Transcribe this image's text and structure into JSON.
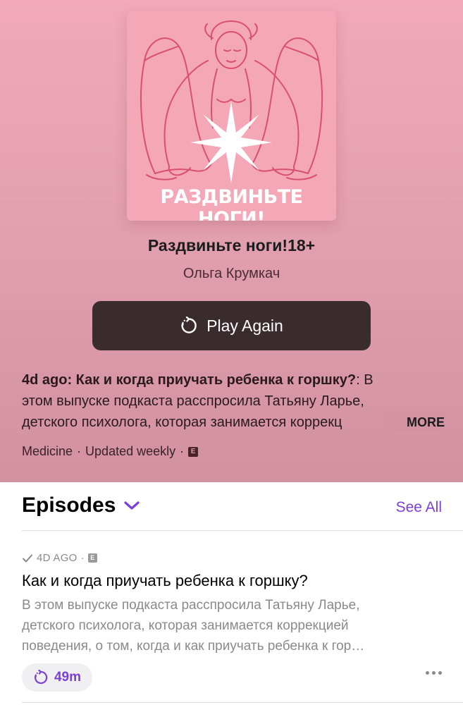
{
  "podcast": {
    "cover_text": "РАЗДВИНЬТЕ НОГИ!",
    "title": "Раздвиньте ноги!18+",
    "author": "Ольга Крумкач",
    "play_label": "Play Again",
    "description": {
      "lead": "4d ago: Как и когда приучать ребенка к горшку?",
      "line1_rest": ": В",
      "line2": "этом выпуске подкаста расспросила Татьяну Ларье,",
      "line3": "детского психолога, которая занимается коррекц",
      "more_label": "MORE"
    },
    "meta": {
      "category": "Medicine",
      "separator": "·",
      "frequency": "Updated weekly",
      "explicit_badge": "E"
    }
  },
  "episodes": {
    "title": "Episodes",
    "see_all": "See All",
    "items": [
      {
        "date": "4D AGO",
        "separator": "·",
        "explicit_badge": "E",
        "title": "Как и когда приучать ребенка к горшку?",
        "description_line1": "В этом выпуске подкаста расспросила Татьяну Ларье,",
        "description_line2": "детского психолога, которая занимается коррекцией",
        "description_line3": "поведения, о том, когда и как приучать ребенка к гор…",
        "duration": "49m"
      }
    ]
  },
  "colors": {
    "accent": "#7b3fd6",
    "hero_top": "#f1a9bb",
    "hero_bottom": "#d291a1",
    "play_button": "#3a2b2e",
    "cover_bg": "#f4a7b7",
    "cover_lines": "#d9506e"
  },
  "icons": {
    "play_again": "replay-icon",
    "episodes_toggle": "chevron-down-icon",
    "played": "checkmark-icon",
    "duration": "replay-icon",
    "more": "ellipsis-icon"
  }
}
